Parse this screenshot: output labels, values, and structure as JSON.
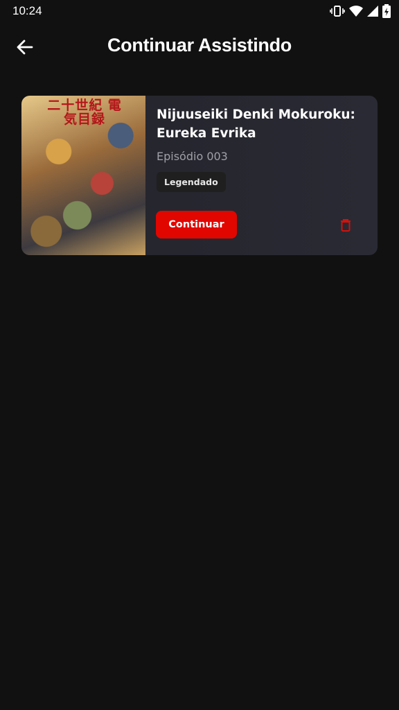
{
  "status_bar": {
    "time": "10:24",
    "icons": [
      "vibrate-icon",
      "wifi-icon",
      "signal-icon",
      "battery-charging-icon"
    ]
  },
  "app_bar": {
    "back_icon": "arrow-left-icon",
    "title": "Continuar Assistindo"
  },
  "items": [
    {
      "poster_text": "二十世紀 電気目録",
      "title": "Nijuuseiki Denki Mokuroku: Eureka Evrika",
      "episode": "Episódio 003",
      "badge": "Legendado",
      "continue_label": "Continuar",
      "delete_icon": "trash-icon"
    }
  ],
  "colors": {
    "background": "#111111",
    "card": "#26262f",
    "accent": "#e10600",
    "delete": "#d3110c"
  }
}
